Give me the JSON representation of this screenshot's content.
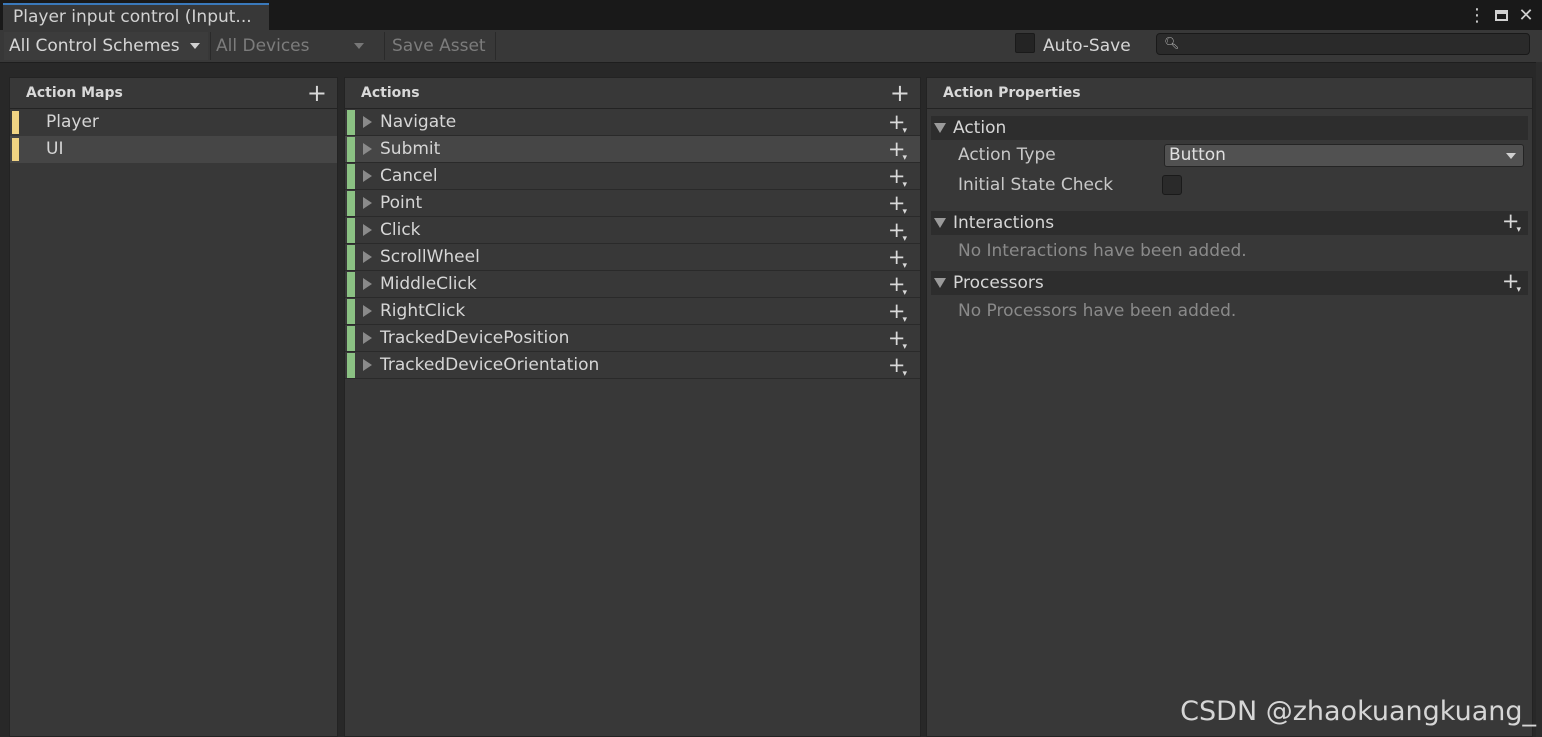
{
  "window": {
    "tab_title": "Player input control (Input...",
    "icons": [
      "kebab-menu-icon",
      "maximize-icon",
      "close-icon"
    ],
    "close_glyph": "✕",
    "menu_glyph": "⋮"
  },
  "toolbar": {
    "control_schemes": "All Control Schemes",
    "devices": "All Devices",
    "save_asset": "Save Asset",
    "auto_save_label": "Auto-Save",
    "auto_save_checked": false,
    "search_value": ""
  },
  "action_maps": {
    "header": "Action Maps",
    "items": [
      {
        "label": "Player",
        "selected": false
      },
      {
        "label": "UI",
        "selected": true
      }
    ]
  },
  "actions": {
    "header": "Actions",
    "items": [
      {
        "label": "Navigate",
        "selected": false
      },
      {
        "label": "Submit",
        "selected": true
      },
      {
        "label": "Cancel",
        "selected": false
      },
      {
        "label": "Point",
        "selected": false
      },
      {
        "label": "Click",
        "selected": false
      },
      {
        "label": "ScrollWheel",
        "selected": false
      },
      {
        "label": "MiddleClick",
        "selected": false
      },
      {
        "label": "RightClick",
        "selected": false
      },
      {
        "label": "TrackedDevicePosition",
        "selected": false
      },
      {
        "label": "TrackedDeviceOrientation",
        "selected": false
      }
    ]
  },
  "properties": {
    "header": "Action Properties",
    "action_section": "Action",
    "action_type_label": "Action Type",
    "action_type_value": "Button",
    "initial_state_label": "Initial State Check",
    "initial_state_checked": false,
    "interactions_section": "Interactions",
    "interactions_empty": "No Interactions have been added.",
    "processors_section": "Processors",
    "processors_empty": "No Processors have been added."
  },
  "watermark": "CSDN @zhaokuangkuang_",
  "colors": {
    "map_accent": "#f0d383",
    "action_accent": "#8bc183",
    "tab_accent": "#3a79bb"
  }
}
